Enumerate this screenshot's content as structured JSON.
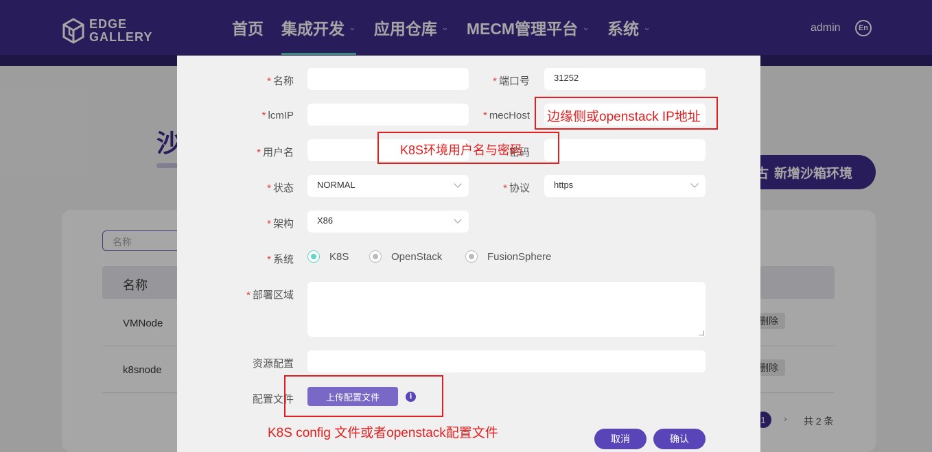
{
  "header": {
    "logo_line1": "EDGE",
    "logo_line2": "GALLERY",
    "nav": [
      {
        "label": "首页",
        "dropdown": false,
        "active": false
      },
      {
        "label": "集成开发",
        "dropdown": true,
        "active": true
      },
      {
        "label": "应用仓库",
        "dropdown": true,
        "active": false
      },
      {
        "label": "MECM管理平台",
        "dropdown": true,
        "active": false
      },
      {
        "label": "系统",
        "dropdown": true,
        "active": false
      }
    ],
    "user": "admin",
    "lang": "En",
    "chevron": "⌄"
  },
  "background": {
    "title_partial": "沙",
    "add_button": "新增沙箱环境",
    "add_button_icon_partial": "古",
    "search_placeholder": "名称",
    "table_header": "名称",
    "rows": [
      {
        "name": "VMNode",
        "delete": "删除"
      },
      {
        "name": "k8snode",
        "delete": "删除"
      }
    ],
    "pagination": {
      "current": "1",
      "next": "›",
      "total": "共 2 条"
    }
  },
  "dialog": {
    "fields": {
      "name": {
        "label": "名称",
        "value": ""
      },
      "port": {
        "label": "端口号",
        "value": "31252"
      },
      "lcmip": {
        "label": "lcmIP",
        "value": ""
      },
      "mechost": {
        "label": "mecHost",
        "value": ""
      },
      "username": {
        "label": "用户名",
        "value": ""
      },
      "password": {
        "label": "密码",
        "value": ""
      },
      "status": {
        "label": "状态",
        "value": "NORMAL"
      },
      "protocol": {
        "label": "协议",
        "value": "https"
      },
      "arch": {
        "label": "架构",
        "value": "X86"
      },
      "system": {
        "label": "系统",
        "options": [
          "K8S",
          "OpenStack",
          "FusionSphere"
        ],
        "selected": "K8S"
      },
      "region": {
        "label": "部署区域",
        "value": ""
      },
      "resource": {
        "label": "资源配置",
        "value": ""
      },
      "config_file": {
        "label": "配置文件",
        "upload_button": "上传配置文件",
        "info_icon": "i"
      }
    },
    "cancel_button": "取消",
    "confirm_button": "确认"
  },
  "annotations": {
    "mechost_note": "边缘侧或openstack IP地址",
    "credentials_note": "K8S环境用户名与密码",
    "config_note": "K8S config 文件或者openstack配置文件",
    "color": "#e02020"
  },
  "colors": {
    "header": "#3f2b8c",
    "accent": "#5a45b8",
    "active_underline": "#5fd6c8",
    "required": "#e03c3c"
  }
}
